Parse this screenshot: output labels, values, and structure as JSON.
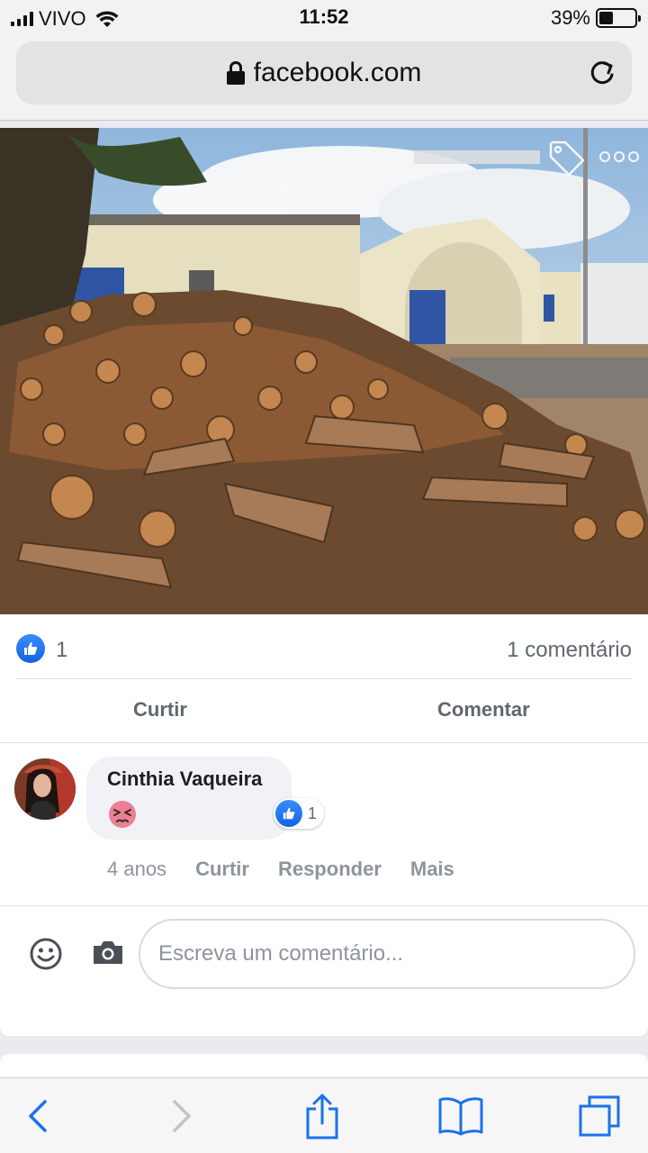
{
  "status_bar": {
    "carrier": "VIVO",
    "time": "11:52",
    "battery_percent": "39%",
    "battery_level": 0.39
  },
  "browser": {
    "url": "facebook.com"
  },
  "post": {
    "reaction_count": "1",
    "comment_count_label": "1 comentário",
    "actions": {
      "like_label": "Curtir",
      "comment_label": "Comentar"
    }
  },
  "comment": {
    "author": "Cinthia Vaqueira",
    "emoji": "face-with-tightly-closed-eyes",
    "reaction_count": "1",
    "time": "4 anos",
    "like_label": "Curtir",
    "reply_label": "Responder",
    "more_label": "Mais"
  },
  "composer": {
    "placeholder": "Escreva um comentário..."
  },
  "colors": {
    "facebook_blue": "#1877f2",
    "ios_blue": "#1a73e8",
    "meta_gray": "#606770"
  }
}
